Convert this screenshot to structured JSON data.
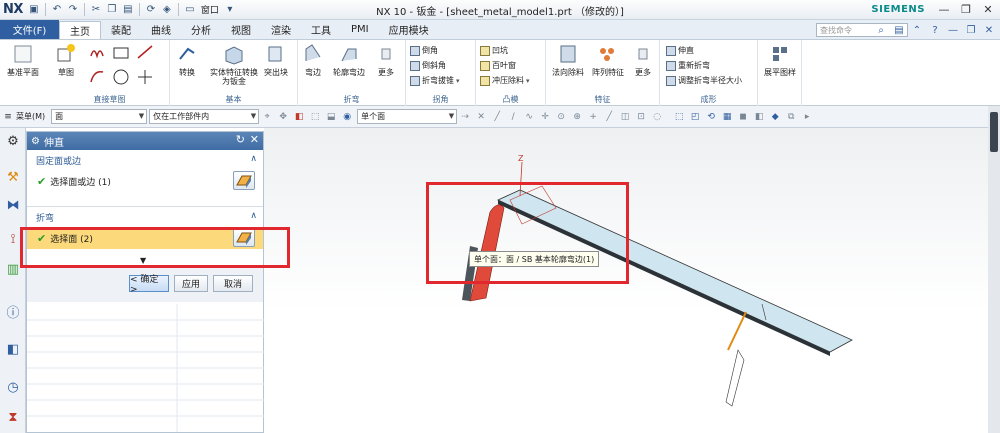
{
  "app": {
    "logo": "NX",
    "title": "NX 10 - 钣金 - [sheet_metal_model1.prt （修改的）]",
    "brand": "SIEMENS",
    "window_menu": "窗口",
    "accent": "#2f5fa0"
  },
  "menu": {
    "file": "文件(F)",
    "tabs": [
      "主页",
      "装配",
      "曲线",
      "分析",
      "视图",
      "渲染",
      "工具",
      "PMI",
      "应用模块"
    ],
    "search_placeholder": "查找命令"
  },
  "ribbon": {
    "datum_plane": "基准平面",
    "sketch": "草图",
    "direct_sketch_label": "直接草图",
    "convert": "转换",
    "solid_to_sheet": "实体特征转换为钣金",
    "extrude_tab": "突出块",
    "basic_label": "基本",
    "flange": "弯边",
    "contour_flange": "轮廓弯边",
    "more1": "更多",
    "bend_label": "折弯",
    "corner_items": [
      "倒角",
      "倒斜角",
      "折弯拔锥"
    ],
    "corner_label": "拐角",
    "emboss_items": [
      "凹坑",
      "百叶窗",
      "冲压除料"
    ],
    "emboss_label": "凸模",
    "normal_cutout": "法向除料",
    "pattern_feature": "阵列特征",
    "more2": "更多",
    "feature_label": "特征",
    "form_items": [
      "伸直",
      "重新折弯",
      "调整折弯半径大小"
    ],
    "form_label": "成形",
    "flat_pattern": "展平图样"
  },
  "selbar": {
    "menu": "菜单(M)",
    "filter": "面",
    "scope": "仅在工作部件内",
    "intent": "单个面"
  },
  "dialog": {
    "title": "伸直",
    "section1": "固定面或边",
    "select1": "选择面或边 (1)",
    "section2": "折弯",
    "select2": "选择面 (2)",
    "ok": "< 确定 >",
    "apply": "应用",
    "cancel": "取消"
  },
  "viewport": {
    "tooltip": "单个面：面 / SB 基本轮廓弯边(1)",
    "axis_z": "Z"
  }
}
